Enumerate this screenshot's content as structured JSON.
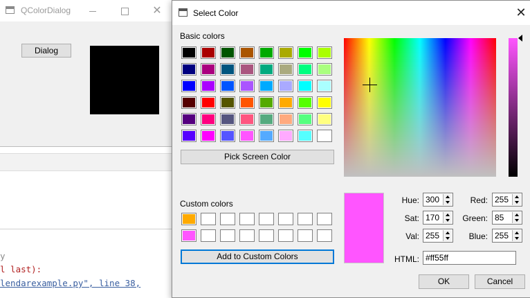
{
  "bg_window": {
    "title": "QColorDialog",
    "dialog_button_label": "Dialog",
    "preview_color": "#000000",
    "close_glyph": "✕"
  },
  "editor": {
    "lines": [
      "y",
      "l last):",
      "lendarexample.py\", line 38,"
    ]
  },
  "dialog": {
    "title": "Select Color",
    "close_glyph": "✕",
    "basic_colors_label": "Basic colors",
    "basic_colors": [
      "#000000",
      "#aa0000",
      "#005500",
      "#aa5500",
      "#00aa00",
      "#aaaa00",
      "#00ff00",
      "#aaff00",
      "#00007f",
      "#aa007f",
      "#00557f",
      "#aa557f",
      "#00aa7f",
      "#aaaa7f",
      "#00ff7f",
      "#aaff7f",
      "#0000ff",
      "#aa00ff",
      "#0055ff",
      "#aa55ff",
      "#00aaff",
      "#aaaaff",
      "#00ffff",
      "#aaffff",
      "#550000",
      "#ff0000",
      "#555500",
      "#ff5500",
      "#55aa00",
      "#ffaa00",
      "#55ff00",
      "#ffff00",
      "#55007f",
      "#ff007f",
      "#55557f",
      "#ff557f",
      "#55aa7f",
      "#ffaa7f",
      "#55ff7f",
      "#ffff7f",
      "#5500ff",
      "#ff00ff",
      "#5555ff",
      "#ff55ff",
      "#55aaff",
      "#ffaaff",
      "#55ffff",
      "#ffffff"
    ],
    "pick_screen_label": "Pick Screen Color",
    "custom_colors_label": "Custom colors",
    "custom_colors": [
      "#ffaa00",
      "#ffffff",
      "#ffffff",
      "#ffffff",
      "#ffffff",
      "#ffffff",
      "#ffffff",
      "#ffffff",
      "#ff55ff",
      "#ffffff",
      "#ffffff",
      "#ffffff",
      "#ffffff",
      "#ffffff",
      "#ffffff",
      "#ffffff"
    ],
    "add_custom_label": "Add to Custom Colors",
    "current_color": "#ff55ff",
    "fields": {
      "hue_label": "Hue:",
      "hue": "300",
      "sat_label": "Sat:",
      "sat": "170",
      "val_label": "Val:",
      "val": "255",
      "red_label": "Red:",
      "red": "255",
      "green_label": "Green:",
      "green": "85",
      "blue_label": "Blue:",
      "blue": "255",
      "html_label": "HTML:",
      "html": "#ff55ff"
    },
    "ok_label": "OK",
    "cancel_label": "Cancel"
  }
}
